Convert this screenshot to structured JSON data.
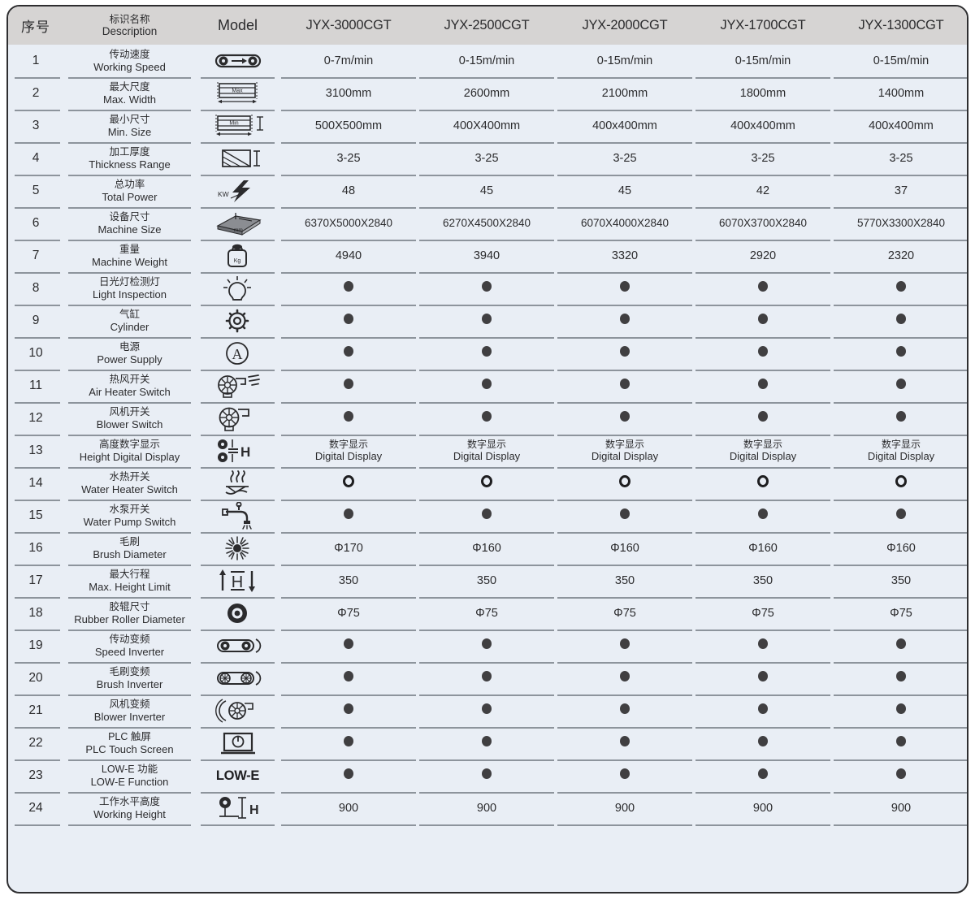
{
  "table": {
    "header": {
      "index_label": "序号",
      "description_cn": "标识名称",
      "description_en": "Description",
      "model_label": "Model",
      "models": [
        "JYX-3000CGT",
        "JYX-2500CGT",
        "JYX-2000CGT",
        "JYX-1700CGT",
        "JYX-1300CGT"
      ]
    },
    "rows": [
      {
        "no": "1",
        "cn": "传动速度",
        "en": "Working Speed",
        "icon": "conveyor-roller-arrow-icon",
        "values": [
          "0-7m/min",
          "0-15m/min",
          "0-15m/min",
          "0-15m/min",
          "0-15m/min"
        ]
      },
      {
        "no": "2",
        "cn": "最大尺度",
        "en": "Max. Width",
        "icon": "max-width-panel-icon",
        "icon_label": "Max",
        "values": [
          "3100mm",
          "2600mm",
          "2100mm",
          "1800mm",
          "1400mm"
        ]
      },
      {
        "no": "3",
        "cn": "最小尺寸",
        "en": "Min. Size",
        "icon": "min-size-panel-icon",
        "icon_label": "Min",
        "values": [
          "500X500mm",
          "400X400mm",
          "400x400mm",
          "400x400mm",
          "400x400mm"
        ]
      },
      {
        "no": "4",
        "cn": "加工厚度",
        "en": "Thickness Range",
        "icon": "glass-thickness-icon",
        "values": [
          "3-25",
          "3-25",
          "3-25",
          "3-25",
          "3-25"
        ]
      },
      {
        "no": "5",
        "cn": "总功率",
        "en": "Total Power",
        "icon": "power-bolt-kw-icon",
        "icon_label": "KW",
        "values": [
          "48",
          "45",
          "45",
          "42",
          "37"
        ]
      },
      {
        "no": "6",
        "cn": "设备尺寸",
        "en": "Machine Size",
        "icon": "machine-dimensions-box-icon",
        "icon_label": "mm",
        "values": [
          "6370X5000X2840",
          "6270X4500X2840",
          "6070X4000X2840",
          "6070X3700X2840",
          "5770X3300X2840"
        ]
      },
      {
        "no": "7",
        "cn": "重量",
        "en": "Machine Weight",
        "icon": "weight-kg-icon",
        "icon_label": "Kg",
        "values": [
          "4940",
          "3940",
          "3320",
          "2920",
          "2320"
        ]
      },
      {
        "no": "8",
        "cn": "日光灯检测灯",
        "en": "Light Inspection",
        "icon": "lightbulb-icon",
        "values": [
          "●",
          "●",
          "●",
          "●",
          "●"
        ]
      },
      {
        "no": "9",
        "cn": "气缸",
        "en": "Cylinder",
        "icon": "gear-cylinder-icon",
        "values": [
          "●",
          "●",
          "●",
          "●",
          "●"
        ]
      },
      {
        "no": "10",
        "cn": "电源",
        "en": "Power Supply",
        "icon": "ampere-circle-icon",
        "values": [
          "●",
          "●",
          "●",
          "●",
          "●"
        ]
      },
      {
        "no": "11",
        "cn": "热风开关",
        "en": "Air Heater Switch",
        "icon": "hot-air-blower-icon",
        "values": [
          "●",
          "●",
          "●",
          "●",
          "●"
        ]
      },
      {
        "no": "12",
        "cn": "风机开关",
        "en": "Blower Switch",
        "icon": "blower-fan-icon",
        "values": [
          "●",
          "●",
          "●",
          "●",
          "●"
        ]
      },
      {
        "no": "13",
        "cn": "高度数字显示",
        "en": "Height Digital Display",
        "icon": "height-digital-display-icon",
        "values": [
          "数字显示|Digital Display",
          "数字显示|Digital Display",
          "数字显示|Digital Display",
          "数字显示|Digital Display",
          "数字显示|Digital Display"
        ]
      },
      {
        "no": "14",
        "cn": "水热开关",
        "en": "Water Heater Switch",
        "icon": "water-heater-icon",
        "values": [
          "○",
          "○",
          "○",
          "○",
          "○"
        ]
      },
      {
        "no": "15",
        "cn": "水泵开关",
        "en": "Water Pump Switch",
        "icon": "water-faucet-icon",
        "values": [
          "●",
          "●",
          "●",
          "●",
          "●"
        ]
      },
      {
        "no": "16",
        "cn": "毛刷",
        "en": "Brush Diameter",
        "icon": "brush-roller-icon",
        "values": [
          "Φ170",
          "Φ160",
          "Φ160",
          "Φ160",
          "Φ160"
        ]
      },
      {
        "no": "17",
        "cn": "最大行程",
        "en": "Max. Height Limit",
        "icon": "height-limit-arrows-icon",
        "icon_label": "H",
        "values": [
          "350",
          "350",
          "350",
          "350",
          "350"
        ]
      },
      {
        "no": "18",
        "cn": "胶辊尺寸",
        "en": "Rubber Roller Diameter",
        "icon": "rubber-roller-icon",
        "values": [
          "Φ75",
          "Φ75",
          "Φ75",
          "Φ75",
          "Φ75"
        ]
      },
      {
        "no": "19",
        "cn": "传动变频",
        "en": "Speed Inverter",
        "icon": "speed-inverter-belt-icon",
        "values": [
          "●",
          "●",
          "●",
          "●",
          "●"
        ]
      },
      {
        "no": "20",
        "cn": "毛刷变频",
        "en": "Brush Inverter",
        "icon": "brush-inverter-belt-icon",
        "values": [
          "●",
          "●",
          "●",
          "●",
          "●"
        ]
      },
      {
        "no": "21",
        "cn": "风机变频",
        "en": "Blower Inverter",
        "icon": "blower-inverter-icon",
        "values": [
          "●",
          "●",
          "●",
          "●",
          "●"
        ]
      },
      {
        "no": "22",
        "cn": "PLC 触屏",
        "en": "PLC Touch Screen",
        "icon": "plc-touch-screen-icon",
        "values": [
          "●",
          "●",
          "●",
          "●",
          "●"
        ]
      },
      {
        "no": "23",
        "cn": "LOW-E 功能",
        "en": "LOW-E Function",
        "icon": "low-e-text-icon",
        "icon_label": "LOW-E",
        "values": [
          "●",
          "●",
          "●",
          "●",
          "●"
        ]
      },
      {
        "no": "24",
        "cn": "工作水平高度",
        "en": "Working Height",
        "icon": "working-height-icon",
        "icon_label": "H",
        "values": [
          "900",
          "900",
          "900",
          "900",
          "900"
        ]
      }
    ]
  },
  "colors": {
    "header_band": "#d6d4d3",
    "row_background": "#e9eef5",
    "border": "#2e2e30",
    "separator": "#8d949c",
    "text": "#2b2b2d",
    "mark": "#403f41"
  }
}
